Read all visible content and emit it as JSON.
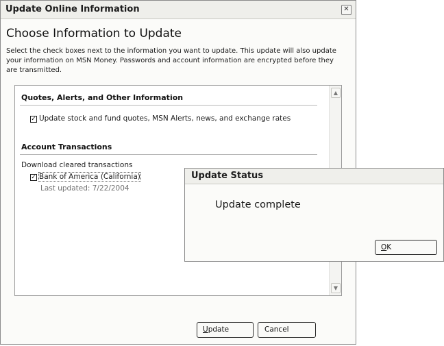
{
  "main_dialog": {
    "title": "Update Online Information",
    "close_glyph": "✕",
    "heading": "Choose Information to Update",
    "description": "Select the check boxes next to the information you want to update. This update will also update your information on MSN Money. Passwords and account information are encrypted before they are transmitted.",
    "sections": {
      "quotes": {
        "title": "Quotes, Alerts, and Other Information",
        "checkbox_label": "Update stock and fund quotes, MSN Alerts, news, and exchange rates",
        "checked": true
      },
      "accounts": {
        "title": "Account Transactions",
        "download_label": "Download cleared transactions",
        "account_label": "Bank of America (California)",
        "account_checked": true,
        "last_updated": "Last updated: 7/22/2004"
      }
    },
    "scroll_up_glyph": "▲",
    "scroll_down_glyph": "▼",
    "buttons": {
      "update_mnemonic": "U",
      "update_rest": "pdate",
      "cancel": "Cancel"
    }
  },
  "status_dialog": {
    "title": "Update Status",
    "message": "Update complete",
    "ok_mnemonic": "O",
    "ok_rest": "K"
  },
  "check_glyph": "✓"
}
